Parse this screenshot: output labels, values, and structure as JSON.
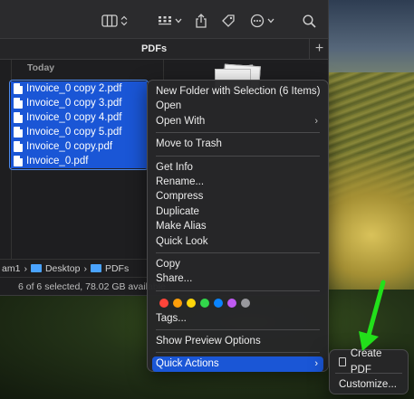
{
  "finder": {
    "tab_title": "PDFs",
    "tab_add": "+",
    "group_header": "Today",
    "files": [
      "Invoice_0 copy 2.pdf",
      "Invoice_0 copy 3.pdf",
      "Invoice_0 copy 4.pdf",
      "Invoice_0 copy 5.pdf",
      "Invoice_0 copy.pdf",
      "Invoice_0.pdf"
    ],
    "path": [
      "am1",
      "Desktop",
      "PDFs"
    ],
    "path_sep": "›",
    "status": "6 of 6 selected, 78.02 GB available"
  },
  "icons": {
    "view_toggle": "columns-view-icon",
    "group": "grid-group-icon",
    "share": "share-icon",
    "tag": "tag-icon",
    "more": "ellipsis-circle-icon",
    "search": "search-icon"
  },
  "context_menu": {
    "items_group1": [
      "New Folder with Selection (6 Items)",
      "Open",
      "Open With",
      "Move to Trash"
    ],
    "items_group2": [
      "Get Info",
      "Rename...",
      "Compress",
      "Duplicate",
      "Make Alias",
      "Quick Look"
    ],
    "items_group3": [
      "Copy",
      "Share..."
    ],
    "tags_label": "Tags...",
    "tag_colors": [
      "#ff453a",
      "#ff9f0a",
      "#ffd60a",
      "#32d74b",
      "#0a84ff",
      "#bf5af2",
      "#98989d"
    ],
    "preview_options": "Show Preview Options",
    "quick_actions": "Quick Actions",
    "chevron": "›"
  },
  "submenu": {
    "create_pdf": "Create PDF",
    "customize": "Customize..."
  },
  "annotation": {
    "arrow_color": "#22e01a"
  }
}
